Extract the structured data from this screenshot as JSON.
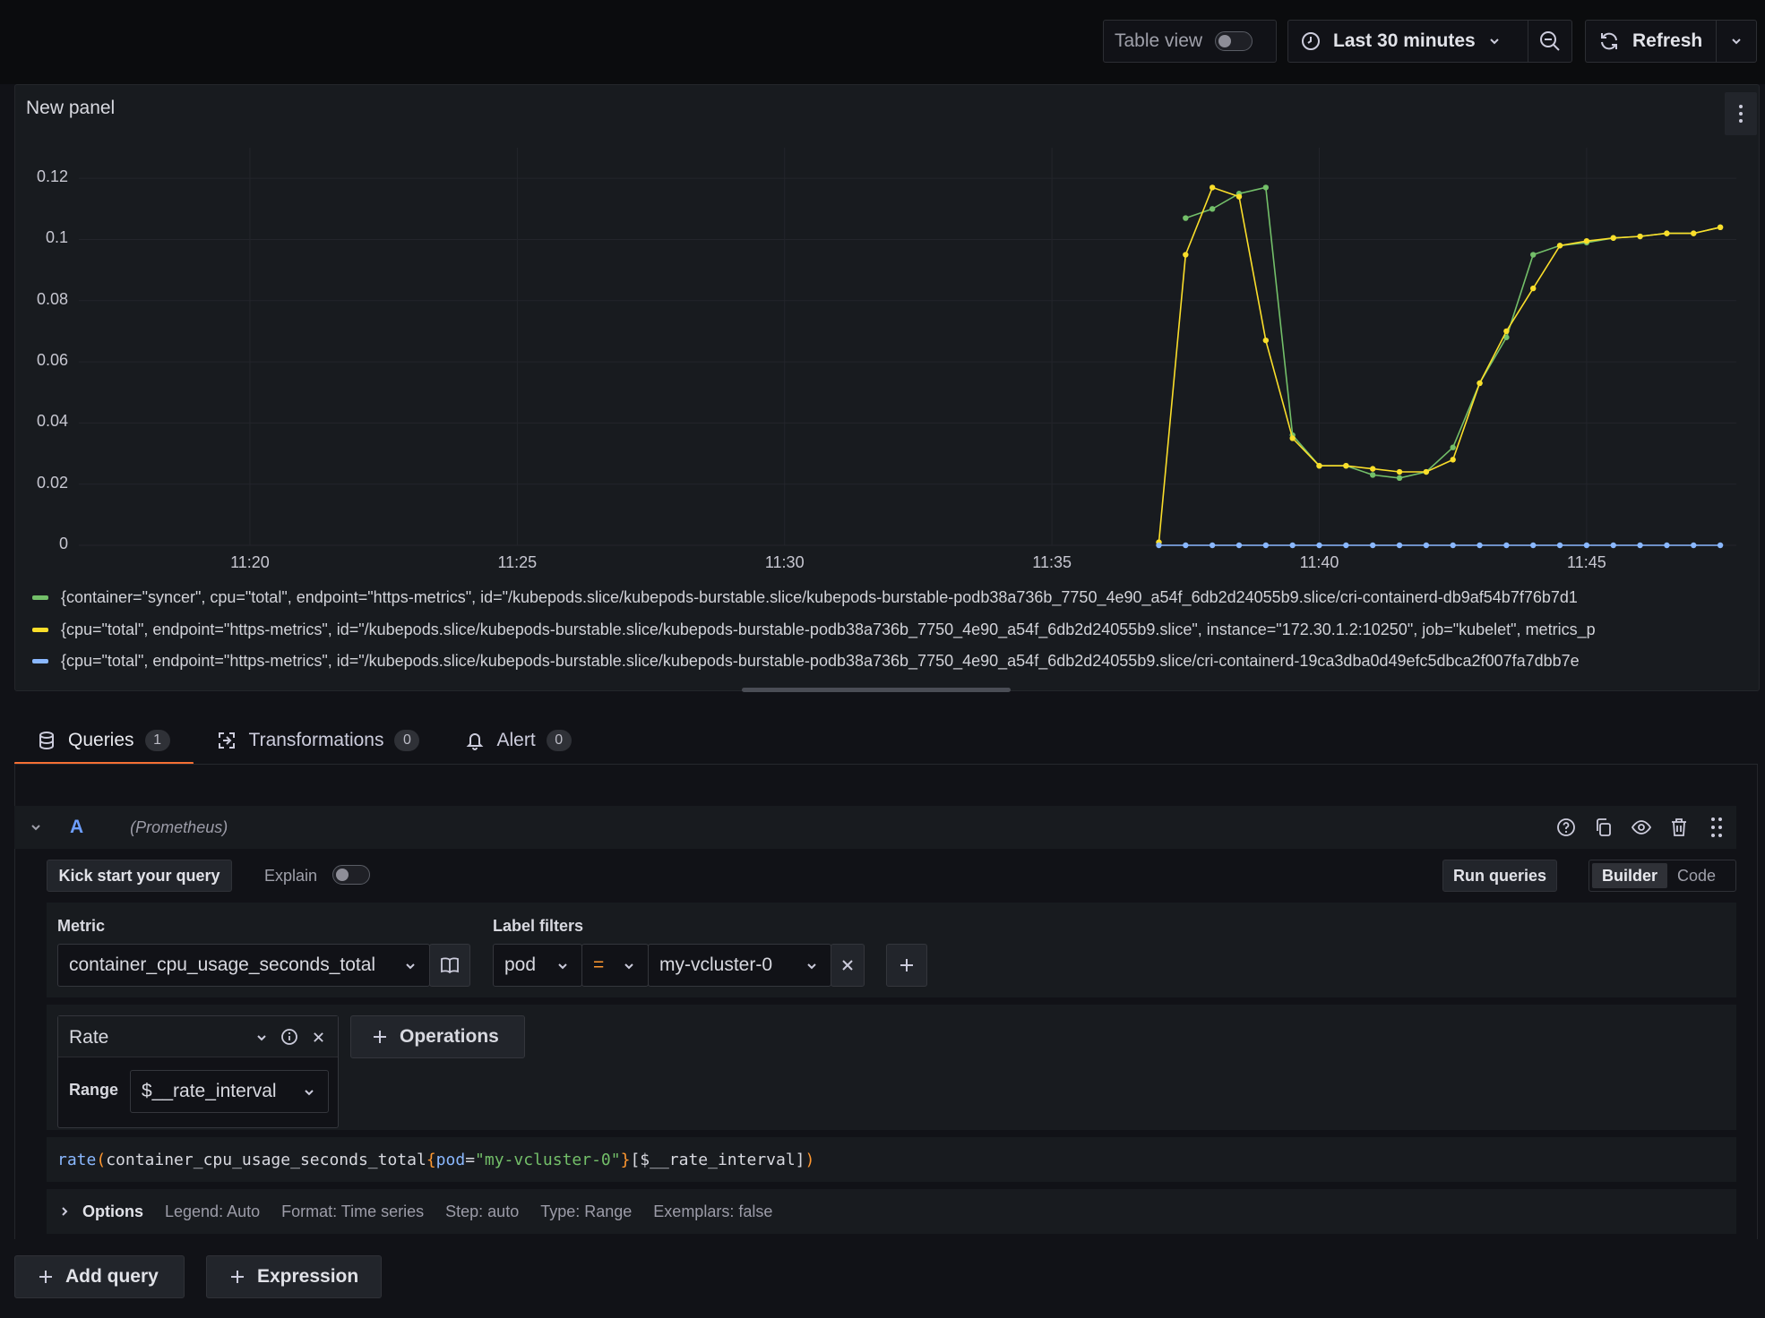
{
  "toolbar": {
    "table_view_label": "Table view",
    "time_range": "Last 30 minutes",
    "refresh_label": "Refresh"
  },
  "panel": {
    "title": "New panel",
    "legend": [
      {
        "label": "{container=\"syncer\", cpu=\"total\", endpoint=\"https-metrics\", id=\"/kubepods.slice/kubepods-burstable.slice/kubepods-burstable-podb38a736b_7750_4e90_a54f_6db2d24055b9.slice/cri-containerd-db9af54b7f76b7d1",
        "color": "#73bf69"
      },
      {
        "label": "{cpu=\"total\", endpoint=\"https-metrics\", id=\"/kubepods.slice/kubepods-burstable.slice/kubepods-burstable-podb38a736b_7750_4e90_a54f_6db2d24055b9.slice\", instance=\"172.30.1.2:10250\", job=\"kubelet\", metrics_p",
        "color": "#fade2a"
      },
      {
        "label": "{cpu=\"total\", endpoint=\"https-metrics\", id=\"/kubepods.slice/kubepods-burstable.slice/kubepods-burstable-podb38a736b_7750_4e90_a54f_6db2d24055b9.slice/cri-containerd-19ca3dba0d49efc5dbca2f007fa7dbb7e",
        "color": "#8ab8ff"
      }
    ]
  },
  "chart_data": {
    "type": "line",
    "x_ticks": [
      "11:20",
      "11:25",
      "11:30",
      "11:35",
      "11:40",
      "11:45"
    ],
    "y_ticks": [
      "0",
      "0.02",
      "0.04",
      "0.06",
      "0.08",
      "0.1",
      "0.12"
    ],
    "ylim": [
      0,
      0.13
    ],
    "x_minutes_range": [
      16.8,
      47.8
    ],
    "grid": true,
    "series": [
      {
        "color": "#73bf69",
        "x_minutes": [
          37.5,
          38.0,
          38.5,
          39.0,
          39.5,
          40.0,
          40.5,
          41.0,
          41.5,
          42.0,
          42.5,
          43.0,
          43.5,
          44.0,
          44.5,
          45.0,
          45.5,
          46.0,
          46.5,
          47.0,
          47.5
        ],
        "values": [
          0.107,
          0.11,
          0.115,
          0.117,
          0.036,
          0.026,
          0.026,
          0.023,
          0.022,
          0.024,
          0.032,
          0.053,
          0.068,
          0.095,
          0.098,
          0.099,
          0.1005,
          0.101,
          0.102,
          0.102,
          0.104
        ]
      },
      {
        "color": "#fade2a",
        "x_minutes": [
          37.0,
          37.5,
          38.0,
          38.5,
          39.0,
          39.5,
          40.0,
          40.5,
          41.0,
          41.5,
          42.0,
          42.5,
          43.0,
          43.5,
          44.0,
          44.5,
          45.0,
          45.5,
          46.0,
          46.5,
          47.0,
          47.5
        ],
        "values": [
          0.001,
          0.095,
          0.117,
          0.114,
          0.067,
          0.035,
          0.026,
          0.026,
          0.025,
          0.024,
          0.024,
          0.028,
          0.053,
          0.07,
          0.084,
          0.098,
          0.0995,
          0.1005,
          0.101,
          0.102,
          0.102,
          0.104
        ]
      },
      {
        "color": "#8ab8ff",
        "x_minutes": [
          37.0,
          37.5,
          38.0,
          38.5,
          39.0,
          39.5,
          40.0,
          40.5,
          41.0,
          41.5,
          42.0,
          42.5,
          43.0,
          43.5,
          44.0,
          44.5,
          45.0,
          45.5,
          46.0,
          46.5,
          47.0,
          47.5
        ],
        "values": [
          0,
          0,
          0,
          0,
          0,
          0,
          0,
          0,
          0,
          0,
          0,
          0,
          0,
          0,
          0,
          0,
          0,
          0,
          0,
          0,
          0,
          0
        ]
      }
    ]
  },
  "tabs": [
    {
      "label": "Queries",
      "count": "1"
    },
    {
      "label": "Transformations",
      "count": "0"
    },
    {
      "label": "Alert",
      "count": "0"
    }
  ],
  "query": {
    "ref_id": "A",
    "datasource": "(Prometheus)",
    "kick_start": "Kick start your query",
    "explain": "Explain",
    "run_queries": "Run queries",
    "builder": "Builder",
    "code": "Code",
    "metric_label": "Metric",
    "metric_value": "container_cpu_usage_seconds_total",
    "label_filters_label": "Label filters",
    "filter_key": "pod",
    "filter_op": "=",
    "filter_value": "my-vcluster-0",
    "operation_name": "Rate",
    "operations_button": "Operations",
    "range_label": "Range",
    "range_value": "$__rate_interval",
    "promql": {
      "fn": "rate",
      "open": "(",
      "metric": "container_cpu_usage_seconds_total",
      "brace_open": "{",
      "label": "pod",
      "eq": "=",
      "value": "\"my-vcluster-0\"",
      "brace_close": "}",
      "range": "[$__rate_interval]",
      "close": ")"
    },
    "options_label": "Options",
    "options": [
      "Legend: Auto",
      "Format: Time series",
      "Step: auto",
      "Type: Range",
      "Exemplars: false"
    ]
  },
  "bottom": {
    "add_query": "Add query",
    "expression": "Expression"
  }
}
